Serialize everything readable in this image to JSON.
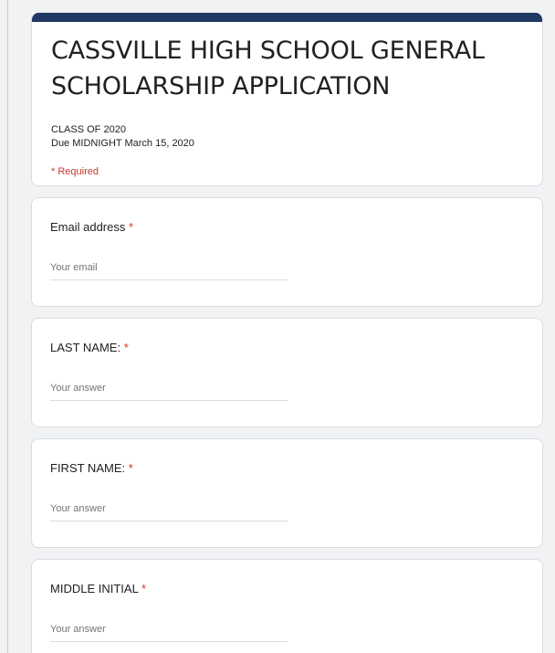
{
  "form": {
    "title": "CASSVILLE HIGH SCHOOL GENERAL SCHOLARSHIP APPLICATION",
    "description_line1": "CLASS OF 2020",
    "description_line2": "Due MIDNIGHT March 15, 2020",
    "required_note": "* Required",
    "accent_color": "#1f3864"
  },
  "questions": [
    {
      "label": "Email address",
      "required_mark": "*",
      "placeholder": "Your email"
    },
    {
      "label": "LAST NAME:",
      "required_mark": "*",
      "placeholder": "Your answer"
    },
    {
      "label": "FIRST NAME:",
      "required_mark": "*",
      "placeholder": "Your answer"
    },
    {
      "label": "MIDDLE INITIAL",
      "required_mark": "*",
      "placeholder": "Your answer"
    }
  ]
}
